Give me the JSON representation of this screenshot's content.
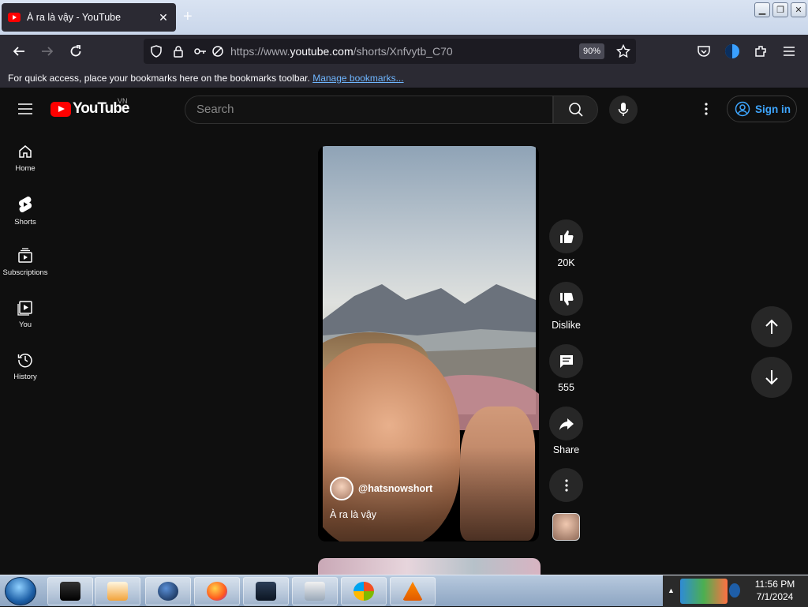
{
  "browser": {
    "tab_title": "À ra là vậy - YouTube",
    "new_tab_label": "+",
    "url_prefix": "https://www.",
    "url_host": "youtube.com",
    "url_path": "/shorts/Xnfvytb_C70",
    "zoom": "90%",
    "bookmarks_hint": "For quick access, place your bookmarks here on the bookmarks toolbar.",
    "bookmarks_link": "Manage bookmarks..."
  },
  "youtube": {
    "logo_word": "YouTube",
    "country": "VN",
    "search_placeholder": "Search",
    "sign_in": "Sign in",
    "sidebar": [
      {
        "label": "Home",
        "icon": "home-icon"
      },
      {
        "label": "Shorts",
        "icon": "shorts-icon"
      },
      {
        "label": "Subscriptions",
        "icon": "subscriptions-icon"
      },
      {
        "label": "You",
        "icon": "you-icon"
      },
      {
        "label": "History",
        "icon": "history-icon"
      }
    ]
  },
  "short": {
    "channel": "@hatsnowshort",
    "caption": "À ra là vậy",
    "likes": "20K",
    "dislike_label": "Dislike",
    "comments": "555",
    "share_label": "Share"
  },
  "taskbar": {
    "time": "11:56 PM",
    "date": "7/1/2024"
  }
}
